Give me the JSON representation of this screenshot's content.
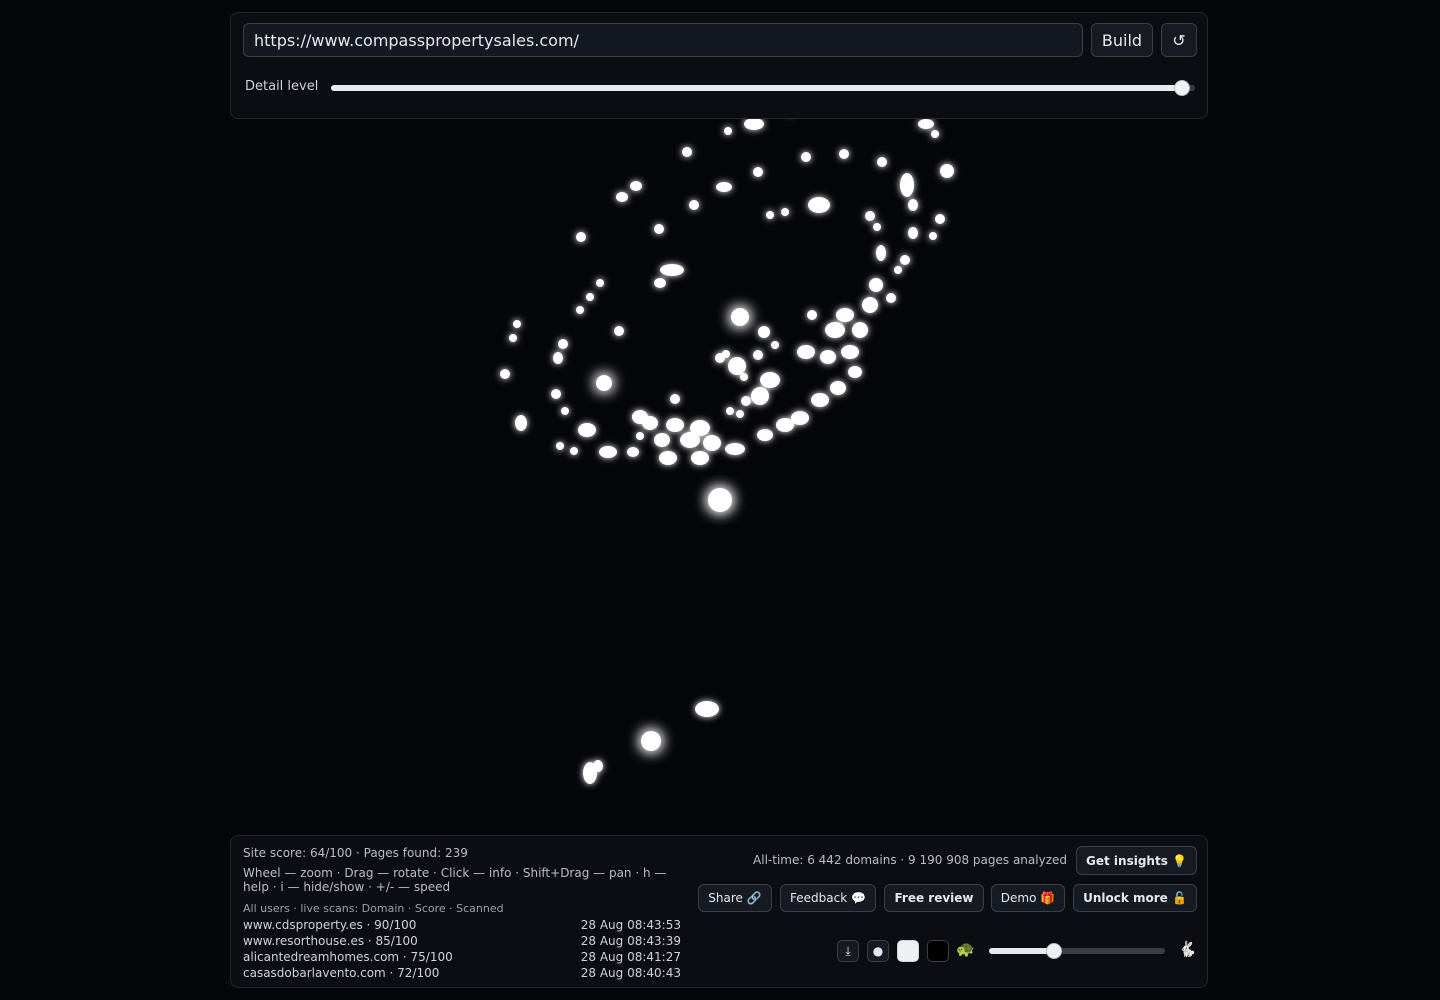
{
  "toolbar": {
    "url_value": "https://www.compasspropertysales.com/",
    "build_label": "Build",
    "reset_label": "↺",
    "detail_label": "Detail level",
    "detail_level": 0.985
  },
  "status": {
    "site_score_text": "Site score: 64/100 · Pages found: 239",
    "help_text": "Wheel — zoom · Drag — rotate · Click — info · Shift+Drag — pan · h — help · i — hide/show · +/- — speed",
    "feed_header": "All users · live scans: Domain · Score · Scanned",
    "feed": [
      {
        "domain": "www.cdsproperty.es · 90/100",
        "time": "28 Aug 08:43:53"
      },
      {
        "domain": "www.resorthouse.es · 85/100",
        "time": "28 Aug 08:43:39"
      },
      {
        "domain": "alicantedreamhomes.com · 75/100",
        "time": "28 Aug 08:41:27"
      },
      {
        "domain": "casasdobarlavento.com · 72/100",
        "time": "28 Aug 08:40:43"
      }
    ]
  },
  "actions": {
    "alltime_text": "All-time: 6 442 domains · 9 190 908 pages analyzed",
    "insights_label": "Get insights 💡",
    "share_label": "Share 🔗",
    "feedback_label": "Feedback 💬",
    "review_label": "Free review",
    "demo_label": "Demo 🎁",
    "unlock_label": "Unlock more 🔓"
  },
  "controls": {
    "download_icon": "⤓",
    "dot_mode_icon": "●",
    "turtle_icon": "🐢",
    "rabbit_icon": "🐇",
    "speed_level": 0.37
  }
}
